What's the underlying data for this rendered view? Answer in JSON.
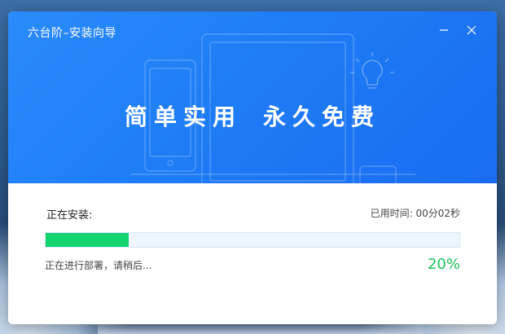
{
  "window": {
    "title": "六台阶–安装向导"
  },
  "banner": {
    "slogan_left": "简单实用",
    "slogan_right": "永久免费"
  },
  "install": {
    "status_label": "正在安装:",
    "elapsed_label": "已用时间: 00分02秒",
    "status_message": "正在进行部署，请稍后...",
    "percent_text": "20%",
    "progress_fraction": 0.2
  },
  "colors": {
    "banner_blue": "#1e7df5",
    "progress_green": "#13d36f",
    "percent_green": "#1ac15a"
  },
  "icons": {
    "minimize": "minimize-icon",
    "close": "close-icon",
    "lightbulb": "lightbulb-icon"
  }
}
